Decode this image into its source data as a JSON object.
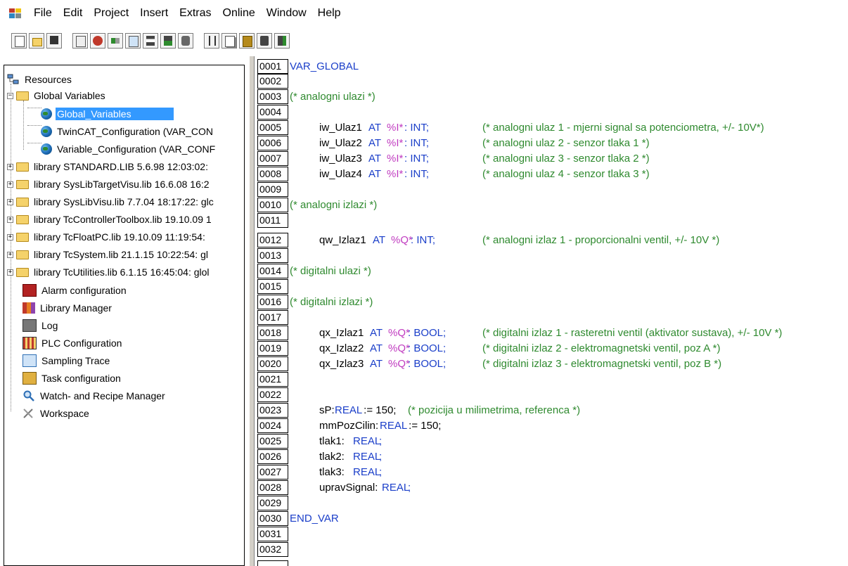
{
  "menu": [
    "File",
    "Edit",
    "Project",
    "Insert",
    "Extras",
    "Online",
    "Window",
    "Help"
  ],
  "toolbar": {
    "group1": [
      "new-icon",
      "open-icon",
      "save-icon"
    ],
    "group2": [
      "login-icon",
      "stop-icon",
      "step-icon",
      "declarations-icon",
      "breakpoint-icon",
      "login2-icon",
      "search-icon"
    ],
    "group3": [
      "cut-icon",
      "copy-icon",
      "paste-icon",
      "find-icon",
      "find-next-icon"
    ]
  },
  "tree": {
    "root": "Resources",
    "global_variables": "Global Variables",
    "children": [
      "Global_Variables",
      "TwinCAT_Configuration (VAR_CON",
      "Variable_Configuration (VAR_CONF"
    ],
    "libraries": [
      "library STANDARD.LIB 5.6.98 12:03:02:",
      "library SysLibTargetVisu.lib 16.6.08 16:2",
      "library SysLibVisu.lib 7.7.04 18:17:22: glc",
      "library TcControllerToolbox.lib 19.10.09 1",
      "library TcFloatPC.lib 19.10.09 11:19:54:",
      "library TcSystem.lib 21.1.15 10:22:54: gl",
      "library TcUtilities.lib 6.1.15 16:45:04: glol"
    ],
    "items": [
      {
        "label": "Alarm configuration",
        "icon": "alarm-icon"
      },
      {
        "label": "Library Manager",
        "icon": "library-manager-icon"
      },
      {
        "label": "Log",
        "icon": "log-icon"
      },
      {
        "label": "PLC Configuration",
        "icon": "plc-configuration-icon"
      },
      {
        "label": "Sampling Trace",
        "icon": "sampling-trace-icon"
      },
      {
        "label": "Task configuration",
        "icon": "task-configuration-icon"
      },
      {
        "label": "Watch- and Recipe Manager",
        "icon": "watch-icon"
      },
      {
        "label": "Workspace",
        "icon": "workspace-icon"
      }
    ]
  },
  "code": {
    "line_numbers": [
      "0001",
      "0002",
      "0003",
      "0004",
      "0005",
      "0006",
      "0007",
      "0008",
      "0009",
      "0010",
      "0011",
      "0012",
      "0013",
      "0014",
      "0015",
      "0016",
      "0017",
      "0018",
      "0019",
      "0020",
      "0021",
      "0022",
      "0023",
      "0024",
      "0025",
      "0026",
      "0027",
      "0028",
      "0029",
      "0030",
      "0031",
      "0032"
    ],
    "l1": "VAR_GLOBAL",
    "l3": "(* analogni ulazi *)",
    "l5": {
      "name": "iw_Ulaz1",
      "at": "AT",
      "addr": "%I*",
      "type": ": INT;",
      "comment": "(* analogni ulaz 1 - mjerni signal sa potenciometra, +/- 10V*)"
    },
    "l6": {
      "name": "iw_Ulaz2",
      "at": "AT",
      "addr": "%I*",
      "type": ": INT;",
      "comment": "(* analogni ulaz 2 - senzor tlaka 1 *)"
    },
    "l7": {
      "name": "iw_Ulaz3",
      "at": "AT",
      "addr": "%I*",
      "type": ": INT;",
      "comment": "(* analogni ulaz 3 - senzor tlaka 2 *)"
    },
    "l8": {
      "name": "iw_Ulaz4",
      "at": "AT",
      "addr": "%I*",
      "type": ": INT;",
      "comment": "(* analogni ulaz 4 - senzor tlaka 3 *)"
    },
    "l10": "(* analogni izlazi *)",
    "l12": {
      "name": "qw_Izlaz1",
      "at": "AT",
      "addr": "%Q*",
      "type": ": INT;",
      "comment": "(* analogni izlaz 1 - proporcionalni ventil, +/- 10V *)"
    },
    "l14": "(* digitalni ulazi *)",
    "l16": "(* digitalni izlazi *)",
    "l18": {
      "name": "qx_Izlaz1",
      "at": "AT",
      "addr": "%Q*",
      "type": ": BOOL;",
      "comment": "(* digitalni izlaz 1 - rasteretni ventil (aktivator sustava), +/- 10V *)"
    },
    "l19": {
      "name": "qx_Izlaz2",
      "at": "AT",
      "addr": "%Q*",
      "type": ": BOOL;",
      "comment": "(* digitalni izlaz 2 - elektromagnetski ventil, poz A *)"
    },
    "l20": {
      "name": "qx_Izlaz3",
      "at": "AT",
      "addr": "%Q*",
      "type": ": BOOL;",
      "comment": "(* digitalni izlaz 3 - elektromagnetski ventil, poz B *)"
    },
    "l23": {
      "name": "sP:",
      "type": "REAL",
      "assign": " := 150;",
      "comment": "(* pozicija u milimetrima, referenca *)"
    },
    "l24": {
      "name": "mmPozCilin:",
      "type": "REAL",
      "assign": " := 150;"
    },
    "l25": {
      "name": "tlak1:",
      "type": "REAL",
      "semi": ";"
    },
    "l26": {
      "name": "tlak2:",
      "type": "REAL",
      "semi": ";"
    },
    "l27": {
      "name": "tlak3:",
      "type": "REAL",
      "semi": ";"
    },
    "l28": {
      "name": "upravSignal:",
      "type": "REAL",
      "semi": ";"
    },
    "l30": "END_VAR"
  },
  "colors": {
    "keyword": "#1a3ec9",
    "comment": "#2f8a2f",
    "address": "#c03cc0",
    "selection": "#3399ff"
  }
}
